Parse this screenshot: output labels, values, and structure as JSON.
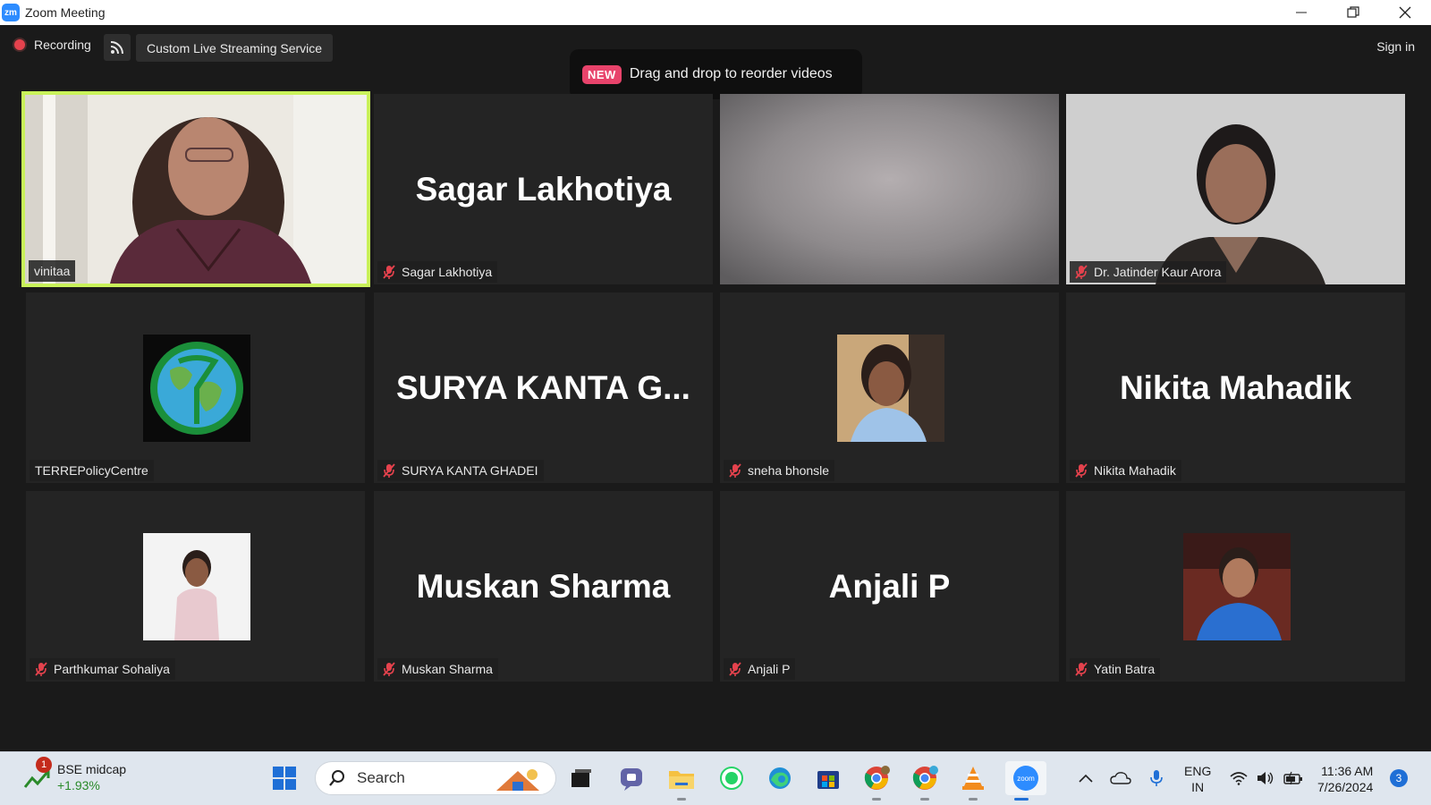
{
  "window": {
    "app_icon_text": "zm",
    "title": "Zoom Meeting"
  },
  "toolbar": {
    "recording_label": "Recording",
    "stream_service_label": "Custom Live Streaming Service",
    "signin_label": "Sign in"
  },
  "toast": {
    "badge": "NEW",
    "message": "Drag and drop to reorder videos"
  },
  "participants": [
    {
      "name": "vinitaa",
      "display": "video",
      "muted": false,
      "active_speaker": true
    },
    {
      "name": "Sagar Lakhotiya",
      "display": "name",
      "big_label": "Sagar Lakhotiya",
      "muted": true
    },
    {
      "name": "",
      "display": "blurred-video",
      "muted": false
    },
    {
      "name": "Dr. Jatinder Kaur Arora",
      "display": "video",
      "muted": true
    },
    {
      "name": "TERREPolicyCentre",
      "display": "avatar",
      "muted": false
    },
    {
      "name": "SURYA KANTA GHADEI",
      "display": "name",
      "big_label": "SURYA KANTA G...",
      "muted": true
    },
    {
      "name": "sneha bhonsle",
      "display": "avatar",
      "muted": true
    },
    {
      "name": "Nikita Mahadik",
      "display": "name",
      "big_label": "Nikita Mahadik",
      "muted": true
    },
    {
      "name": "Parthkumar Sohaliya",
      "display": "avatar",
      "muted": true
    },
    {
      "name": "Muskan Sharma",
      "display": "name",
      "big_label": "Muskan Sharma",
      "muted": true
    },
    {
      "name": "Anjali P",
      "display": "name",
      "big_label": "Anjali P",
      "muted": true
    },
    {
      "name": "Yatin Batra",
      "display": "avatar",
      "muted": true
    }
  ],
  "taskbar": {
    "widget": {
      "badge": "1",
      "title": "BSE midcap",
      "change": "+1.93%"
    },
    "search_placeholder": "Search",
    "lang_line1": "ENG",
    "lang_line2": "IN",
    "time": "11:36 AM",
    "date": "7/26/2024",
    "notifications": "3"
  },
  "colors": {
    "active_speaker_border": "#c9f25a",
    "muted_icon": "#e5424d",
    "new_badge": "#e8436b",
    "tile_bg": "#242424",
    "meeting_bg": "#1a1a1a"
  }
}
